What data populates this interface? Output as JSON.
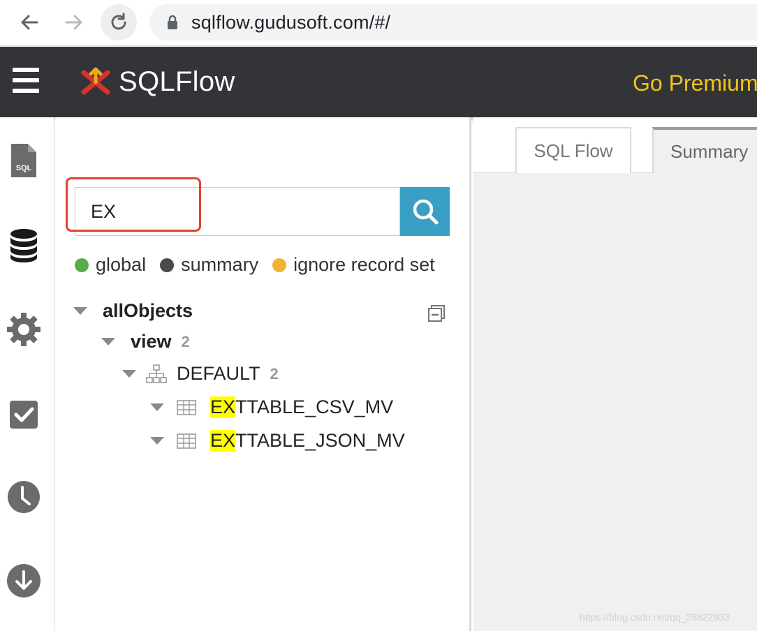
{
  "browser": {
    "url": "sqlflow.gudusoft.com/#/"
  },
  "header": {
    "app_name": "SQLFlow",
    "premium_label": "Go Premium"
  },
  "rail": {
    "sql_icon_label": "SQL"
  },
  "search": {
    "value": "EX"
  },
  "legend": {
    "items": [
      {
        "label": "global",
        "color": "#5aab46"
      },
      {
        "label": "summary",
        "color": "#4a4a4a"
      },
      {
        "label": "ignore record set",
        "color": "#f2b233"
      }
    ]
  },
  "tree": {
    "root": {
      "label": "allObjects"
    },
    "view": {
      "label": "view",
      "count": "2"
    },
    "schema": {
      "label": "DEFAULT",
      "count": "2"
    },
    "tables": [
      {
        "match": "EX",
        "rest": "TTABLE_CSV_MV"
      },
      {
        "match": "EX",
        "rest": "TTABLE_JSON_MV"
      }
    ]
  },
  "tabs": [
    {
      "label": "SQL Flow"
    },
    {
      "label": "Summary"
    }
  ],
  "watermark": "https://blog.csdn.net/qq_28822933",
  "colors": {
    "header_bg": "#333438",
    "premium": "#f0c419",
    "search_button": "#3a9fc4",
    "highlight": "#ffff00",
    "annotation": "#e0432f"
  }
}
